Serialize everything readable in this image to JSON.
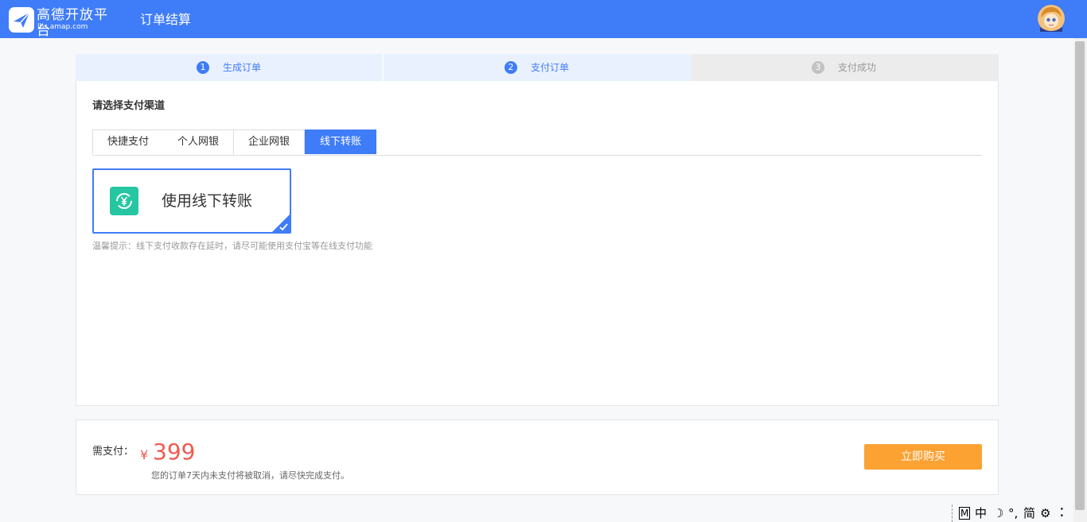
{
  "header": {
    "logo_cn": "高德开放平台",
    "logo_en": "lbs.amap.com",
    "page_title": "订单结算",
    "brand_color": "#3f7cf7"
  },
  "steps": [
    {
      "num": "1",
      "label": "生成订单",
      "state": "active"
    },
    {
      "num": "2",
      "label": "支付订单",
      "state": "active"
    },
    {
      "num": "3",
      "label": "支付成功",
      "state": "inactive"
    }
  ],
  "payment": {
    "section_title": "请选择支付渠道",
    "tabs": [
      "快捷支付",
      "个人网银",
      "企业网银",
      "线下转账"
    ],
    "selected_tab": "线下转账",
    "option_label": "使用线下转账",
    "option_icon": "yen-exchange-icon",
    "tip": "温馨提示：线下支付收款存在延时，请尽可能使用支付宝等在线支付功能"
  },
  "checkout": {
    "need_label": "需支付：",
    "currency": "¥",
    "amount": "399",
    "note": "您的订单7天内未支付将被取消，请尽快完成支付。",
    "buy_label": "立即购买",
    "price_color": "#f05a4f",
    "button_color": "#fba232"
  },
  "ime": {
    "mode": "M",
    "lang": "中",
    "moon": "☽",
    "punct": "°,",
    "script": "简",
    "gear": "⚙",
    "more": "⠅"
  }
}
